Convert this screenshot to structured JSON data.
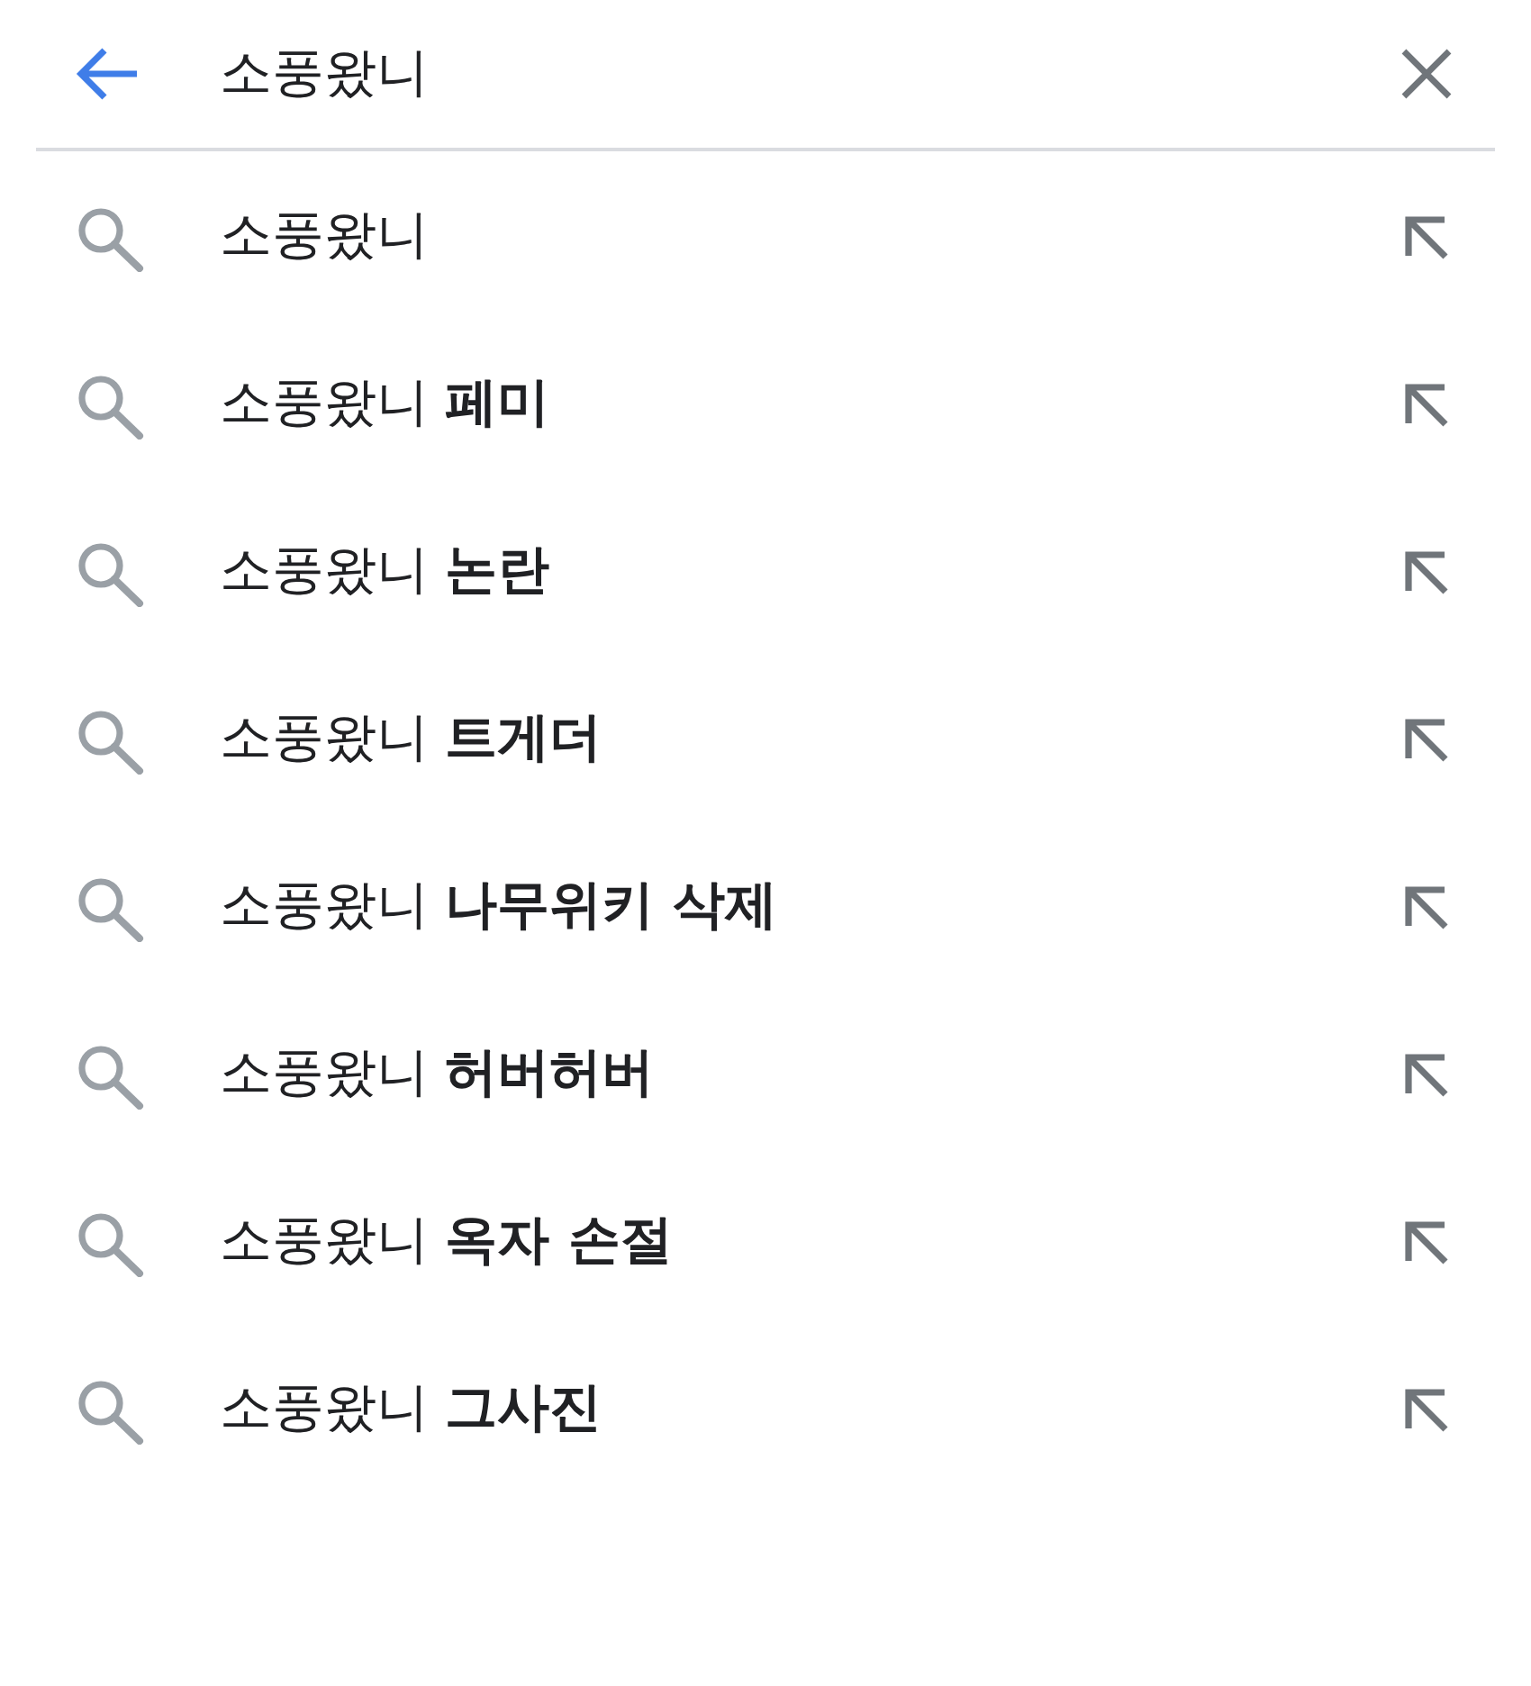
{
  "search_bar": {
    "value": "소풍왔니"
  },
  "suggestions": [
    {
      "text": "소풍왔니"
    },
    {
      "text": "소풍왔니 **페미**"
    },
    {
      "text": "소풍왔니 **논란**"
    },
    {
      "text": "소풍왔니 **트게더**"
    },
    {
      "text": "소풍왔니 **나무위키 삭제**"
    },
    {
      "text": "소풍왔니 **허버허버**"
    },
    {
      "text": "소풍왔니 **옥자 손절**"
    },
    {
      "text": "소풍왔니 **그사진**"
    }
  ]
}
